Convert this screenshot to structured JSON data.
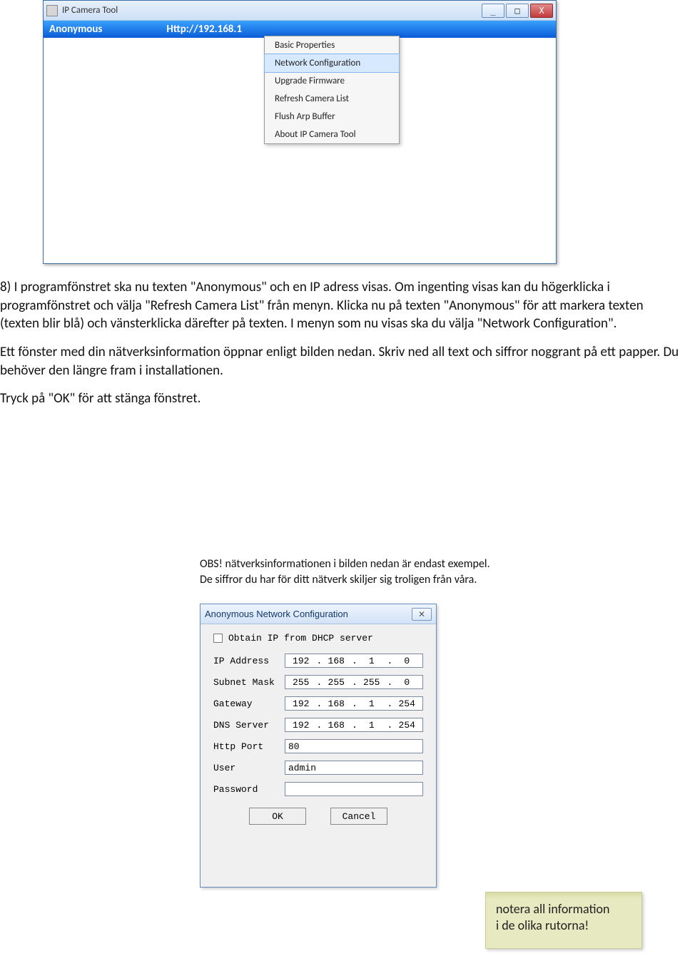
{
  "main_window": {
    "title": "IP Camera Tool",
    "selected_row": {
      "name": "Anonymous",
      "url": "Http://192.168.1"
    },
    "context_menu": [
      "Basic Properties",
      "Network Configuration",
      "Upgrade Firmware",
      "Refresh Camera List",
      "Flush Arp Buffer",
      "About IP Camera Tool"
    ],
    "highlighted_index": 1
  },
  "body_text": {
    "p1": "8) I programfönstret ska nu texten \"Anonymous\" och en IP adress visas. Om ingenting visas kan du högerklicka i programfönstret och välja \"Refresh Camera List\" från menyn. Klicka nu på texten \"Anonymous\" för att markera texten (texten blir blå) och vänsterklicka därefter på texten. I menyn som nu visas ska du välja \"Network Configuration\".",
    "p2": "Ett fönster med din nätverksinformation öppnar enligt bilden nedan. Skriv ned all text och siffror noggrant på ett papper. Du behöver den längre fram i installationen.",
    "p3": "Tryck på \"OK\" för att stänga fönstret."
  },
  "obs": {
    "line1": "OBS! nätverksinformationen i bilden nedan är endast exempel.",
    "line2": "De siffror du har för ditt nätverk skiljer sig troligen från våra."
  },
  "dialog": {
    "title": "Anonymous Network Configuration",
    "dhcp_label": "Obtain IP from DHCP server",
    "fields": {
      "ip_label": "IP Address",
      "ip": [
        "192",
        "168",
        "1",
        "0"
      ],
      "subnet_label": "Subnet Mask",
      "subnet": [
        "255",
        "255",
        "255",
        "0"
      ],
      "gw_label": "Gateway",
      "gw": [
        "192",
        "168",
        "1",
        "254"
      ],
      "dns_label": "DNS Server",
      "dns": [
        "192",
        "168",
        "1",
        "254"
      ],
      "port_label": "Http Port",
      "port": "80",
      "user_label": "User",
      "user": "admin",
      "pass_label": "Password",
      "pass": ""
    },
    "ok": "OK",
    "cancel": "Cancel"
  },
  "sticky": {
    "line1": "notera all information",
    "line2": "i de olika rutorna!"
  },
  "winbtn": {
    "min": "_",
    "max": "□",
    "close": "X",
    "x": "✕"
  }
}
